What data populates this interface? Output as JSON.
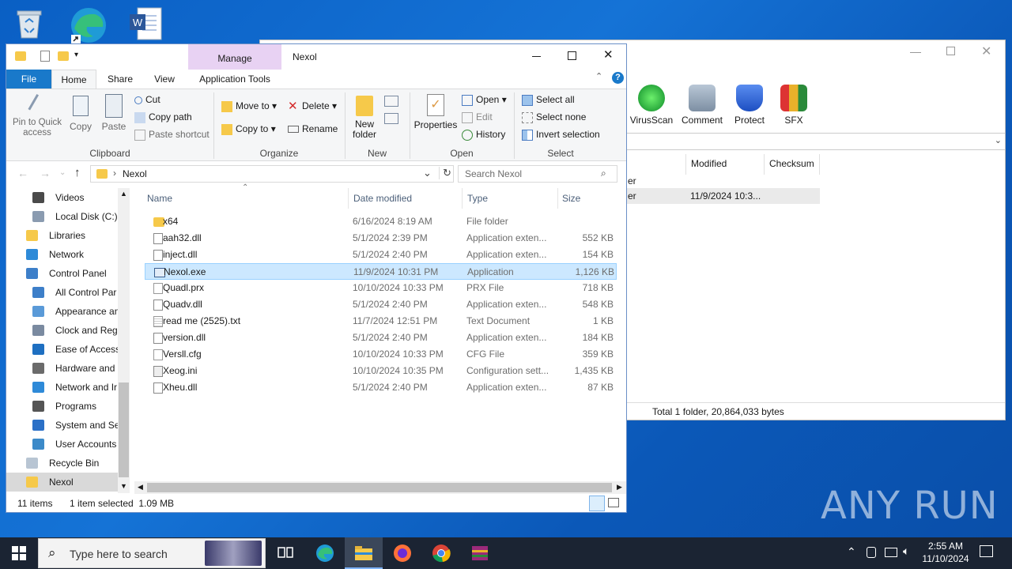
{
  "explorer": {
    "title": "Nexol",
    "manage_tab": "Manage",
    "tabs": [
      "File",
      "Home",
      "Share",
      "View",
      "Application Tools"
    ],
    "clipboard": {
      "pin": "Pin to Quick access",
      "copy": "Copy",
      "paste": "Paste",
      "cut": "Cut",
      "copy_path": "Copy path",
      "paste_shortcut": "Paste shortcut",
      "title": "Clipboard"
    },
    "organize": {
      "move_to": "Move to",
      "copy_to": "Copy to",
      "delete": "Delete",
      "rename": "Rename",
      "title": "Organize"
    },
    "new": {
      "new_folder": "New folder",
      "title": "New"
    },
    "open": {
      "properties": "Properties",
      "open": "Open",
      "edit": "Edit",
      "history": "History",
      "title": "Open"
    },
    "select": {
      "select_all": "Select all",
      "select_none": "Select none",
      "invert": "Invert selection",
      "title": "Select"
    },
    "address": "Nexol",
    "search_placeholder": "Search Nexol",
    "nav": [
      {
        "label": "Videos",
        "icon": "videos-icon"
      },
      {
        "label": "Local Disk (C:)",
        "icon": "disk-icon"
      },
      {
        "label": "Libraries",
        "icon": "libraries-icon"
      },
      {
        "label": "Network",
        "icon": "network-icon"
      },
      {
        "label": "Control Panel",
        "icon": "control-panel-icon"
      },
      {
        "label": "All Control Par",
        "icon": "control-panel-icon"
      },
      {
        "label": "Appearance an",
        "icon": "appearance-icon"
      },
      {
        "label": "Clock and Regi",
        "icon": "clock-icon"
      },
      {
        "label": "Ease of Access",
        "icon": "ease-icon"
      },
      {
        "label": "Hardware and",
        "icon": "hardware-icon"
      },
      {
        "label": "Network and Ir",
        "icon": "network-icon"
      },
      {
        "label": "Programs",
        "icon": "programs-icon"
      },
      {
        "label": "System and Sec",
        "icon": "shield-icon"
      },
      {
        "label": "User Accounts",
        "icon": "users-icon"
      },
      {
        "label": "Recycle Bin",
        "icon": "recycle-bin-icon"
      },
      {
        "label": "Nexol",
        "icon": "folder-icon"
      }
    ],
    "columns": {
      "name": "Name",
      "date": "Date modified",
      "type": "Type",
      "size": "Size"
    },
    "files": [
      {
        "name": "x64",
        "date": "6/16/2024 8:19 AM",
        "type": "File folder",
        "size": "",
        "icon": "folder"
      },
      {
        "name": "aah32.dll",
        "date": "5/1/2024 2:39 PM",
        "type": "Application exten...",
        "size": "552 KB",
        "icon": "dll"
      },
      {
        "name": "inject.dll",
        "date": "5/1/2024 2:40 PM",
        "type": "Application exten...",
        "size": "154 KB",
        "icon": "dll"
      },
      {
        "name": "Nexol.exe",
        "date": "11/9/2024 10:31 PM",
        "type": "Application",
        "size": "1,126 KB",
        "icon": "exe"
      },
      {
        "name": "Quadl.prx",
        "date": "10/10/2024 10:33 PM",
        "type": "PRX File",
        "size": "718 KB",
        "icon": "file"
      },
      {
        "name": "Quadv.dll",
        "date": "5/1/2024 2:40 PM",
        "type": "Application exten...",
        "size": "548 KB",
        "icon": "dll"
      },
      {
        "name": "read me (2525).txt",
        "date": "11/7/2024 12:51 PM",
        "type": "Text Document",
        "size": "1 KB",
        "icon": "txt"
      },
      {
        "name": "version.dll",
        "date": "5/1/2024 2:40 PM",
        "type": "Application exten...",
        "size": "184 KB",
        "icon": "dll"
      },
      {
        "name": "Versll.cfg",
        "date": "10/10/2024 10:33 PM",
        "type": "CFG File",
        "size": "359 KB",
        "icon": "file"
      },
      {
        "name": "Xeog.ini",
        "date": "10/10/2024 10:35 PM",
        "type": "Configuration sett...",
        "size": "1,435 KB",
        "icon": "ini"
      },
      {
        "name": "Xheu.dll",
        "date": "5/1/2024 2:40 PM",
        "type": "Application exten...",
        "size": "87 KB",
        "icon": "dll"
      }
    ],
    "status": {
      "items": "11 items",
      "selected": "1 item selected  1.09 MB"
    }
  },
  "winrar": {
    "toolbar": [
      "VirusScan",
      "Comment",
      "Protect",
      "SFX"
    ],
    "columns": {
      "modified": "Modified",
      "checksum": "Checksum"
    },
    "rows": [
      {
        "c1": "er",
        "modified": ""
      },
      {
        "c1": "er",
        "modified": "11/9/2024 10:3..."
      }
    ],
    "status": "Total 1 folder, 20,864,033 bytes"
  },
  "taskbar": {
    "search_placeholder": "Type here to search",
    "time": "2:55 AM",
    "date": "11/10/2024"
  },
  "watermark": "ANY RUN",
  "colors": {
    "accent": "#1979ca",
    "selected": "#cce8ff",
    "manage": "#e8d2f3",
    "taskbar": "#1b2433"
  }
}
